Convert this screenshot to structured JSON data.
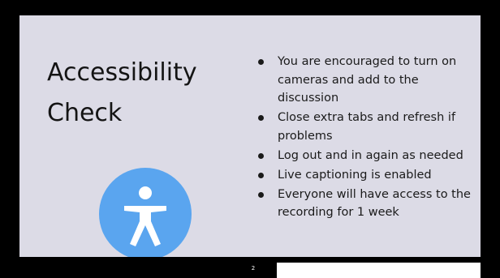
{
  "slide": {
    "title_lines": [
      "Accessibility",
      "Check"
    ],
    "icon": "accessibility-person-icon",
    "icon_color": "#5aa5ef",
    "background_color": "#dcdbe6",
    "bullets": [
      "You are encouraged to turn on cameras and add to the discussion",
      "Close extra tabs and refresh if problems",
      "Log out and in again as needed",
      "Live captioning is enabled",
      "Everyone will have access to the recording for 1 week"
    ]
  },
  "footer": {
    "page_number": "2"
  }
}
